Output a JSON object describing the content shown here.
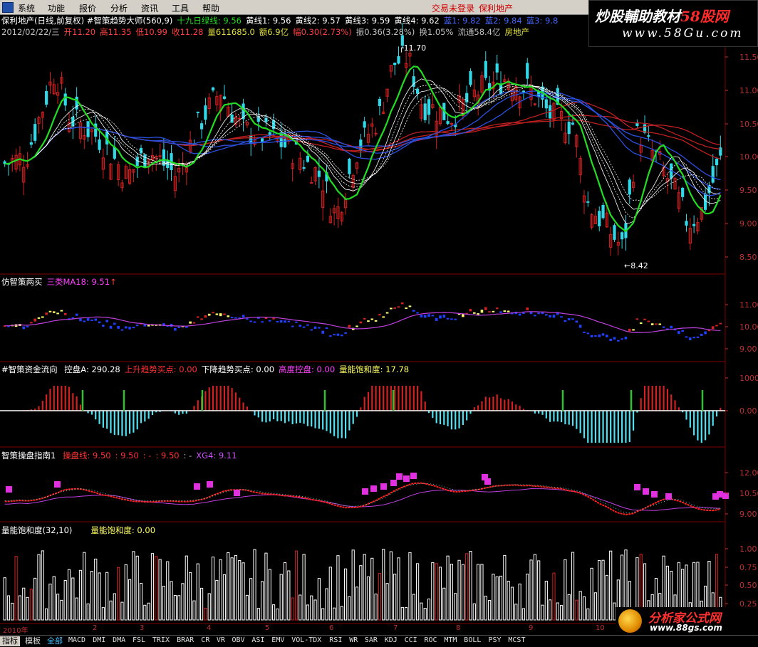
{
  "menubar": {
    "items": [
      "系统",
      "功能",
      "报价",
      "分析",
      "资讯",
      "工具",
      "帮助"
    ],
    "status_login": "交易未登录",
    "status_stock": "保利地产"
  },
  "watermark": {
    "line1_a": "炒股輔助教材",
    "line1_b": "58股网",
    "line2": "www.58Gu.com"
  },
  "main_panel": {
    "title": "保利地产(日线,前复权) #智策趋势大师(560,9)",
    "ind_items": [
      {
        "label": "十九日绿线: 9.56",
        "color": "#22dd22"
      },
      {
        "label": "黄线1: 9.56",
        "color": "#ffffff"
      },
      {
        "label": "黄线2: 9.57",
        "color": "#ffffff"
      },
      {
        "label": "黄线3: 9.59",
        "color": "#ffffff"
      },
      {
        "label": "黄线4: 9.62",
        "color": "#ffffff"
      },
      {
        "label": "蓝1: 9.82",
        "color": "#4466ff"
      },
      {
        "label": "蓝2: 9.84",
        "color": "#4466ff"
      },
      {
        "label": "蓝3: 9.8",
        "color": "#4466ff"
      }
    ],
    "quote_items": [
      {
        "label": "2012/02/22/三",
        "color": "#c0c0c0"
      },
      {
        "label": "开11.20",
        "color": "#ff4040"
      },
      {
        "label": "高11.35",
        "color": "#ff4040"
      },
      {
        "label": "低10.99",
        "color": "#ff4040"
      },
      {
        "label": "收11.28",
        "color": "#ff4040"
      },
      {
        "label": "量611685.0",
        "color": "#e0e040"
      },
      {
        "label": "额6.9亿",
        "color": "#e0e040"
      },
      {
        "label": "幅0.30(2.73%)",
        "color": "#ff4040"
      },
      {
        "label": "振0.36(3.28%)",
        "color": "#c0c0c0"
      },
      {
        "label": "换1.05%",
        "color": "#c0c0c0"
      },
      {
        "label": "流通58.4亿",
        "color": "#c0c0c0"
      },
      {
        "label": "房地产",
        "color": "#e0e040"
      }
    ],
    "y_labels": [
      "11.50",
      "11.00",
      "10.50",
      "10.00",
      "9.50",
      "9.00",
      "8.50"
    ],
    "high_mark": "11.70",
    "low_mark": "8.42"
  },
  "panel2": {
    "title": "仿智策两买",
    "ind": "三类MA18: 9.51",
    "y_labels": [
      "11.00",
      "10.00",
      "9.00"
    ]
  },
  "panel3": {
    "title": "#智策资金流向",
    "items": [
      {
        "label": "控盘A: 290.28",
        "color": "#ffffff"
      },
      {
        "label": "上升趋势买点: 0.00",
        "color": "#ff3030"
      },
      {
        "label": "下降趋势买点: 0.00",
        "color": "#ffffff"
      },
      {
        "label": "高度控盘: 0.00",
        "color": "#ff40ff"
      },
      {
        "label": "量能饱和度: 17.78",
        "color": "#ffff60"
      }
    ],
    "y_labels": [
      "1000",
      "0.00"
    ]
  },
  "panel4": {
    "title": "智策操盘指南1",
    "items": [
      {
        "label": "操盘线: 9.50",
        "color": "#ff3030"
      },
      {
        "label": ": 9.50",
        "color": "#ff3030"
      },
      {
        "label": ": -",
        "color": "#ff3030"
      },
      {
        "label": ": 9.50",
        "color": "#ff3030"
      },
      {
        "label": ": -",
        "color": "#c0c0c0"
      },
      {
        "label": "XG4: 9.11",
        "color": "#d050ff"
      }
    ],
    "y_labels": [
      "12.00",
      "10.50",
      "9.00"
    ]
  },
  "panel5": {
    "title": "量能饱和度(32,10)",
    "ind": "量能饱和度: 0.00",
    "y_labels": [
      "1.00",
      "0.75",
      "0.50",
      "0.25"
    ]
  },
  "x_axis": {
    "labels": [
      "2010年",
      "2",
      "3",
      "4",
      "5",
      "6",
      "7",
      "8",
      "9",
      "10"
    ]
  },
  "bottom_tabs": {
    "tabs": [
      "指标",
      "模板",
      "全部"
    ],
    "indicators": [
      "MACD",
      "DMI",
      "DMA",
      "FSL",
      "TRIX",
      "BRAR",
      "CR",
      "VR",
      "OBV",
      "ASI",
      "EMV",
      "VOL-TDX",
      "RSI",
      "WR",
      "SAR",
      "KDJ",
      "CCI",
      "ROC",
      "MTM",
      "BOLL",
      "PSY",
      "MCST"
    ]
  },
  "logo": {
    "name": "分析家公式网",
    "url": "www.88gs.com"
  },
  "colors": {
    "up": "#d42020",
    "down": "#30d8e8",
    "green_line": "#22dd22",
    "blue_line": "#2a50e0",
    "red_line": "#c02020",
    "grid": "#800000"
  }
}
